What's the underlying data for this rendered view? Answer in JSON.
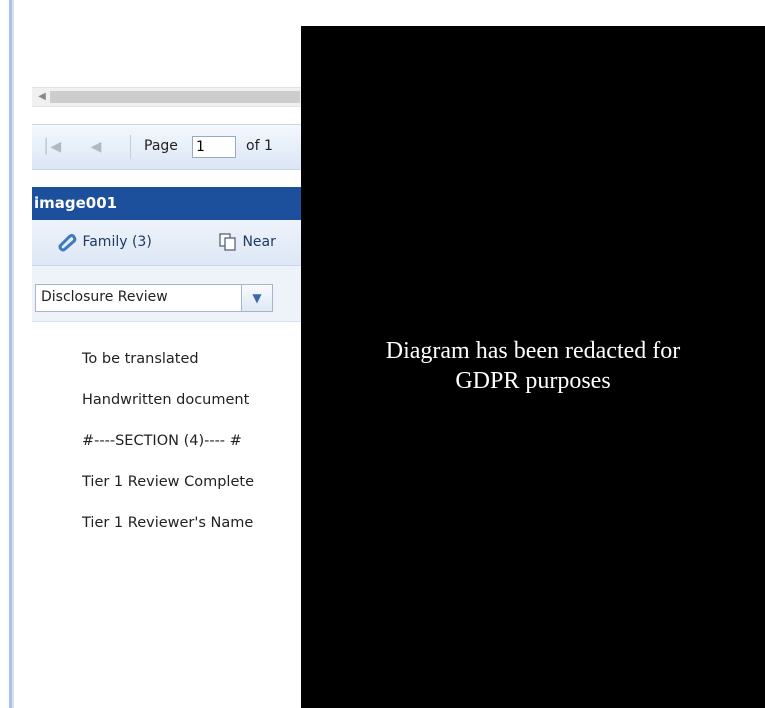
{
  "pager": {
    "page_label": "Page",
    "page_value": "1",
    "of_label": "of 1"
  },
  "document": {
    "title": "image001"
  },
  "toolbar": {
    "family_label": "Family (3)",
    "near_label": "Near"
  },
  "review_dropdown": {
    "selected": "Disclosure Review"
  },
  "fields": [
    "To be translated",
    "Handwritten document",
    "#----SECTION (4)---- #",
    "Tier 1 Review Complete",
    "Tier 1 Reviewer's Name"
  ],
  "redaction": {
    "message_line1": "Diagram has been redacted for",
    "message_line2": "GDPR purposes"
  },
  "colors": {
    "title_bar": "#1c4f9c",
    "redaction": "#000000"
  }
}
